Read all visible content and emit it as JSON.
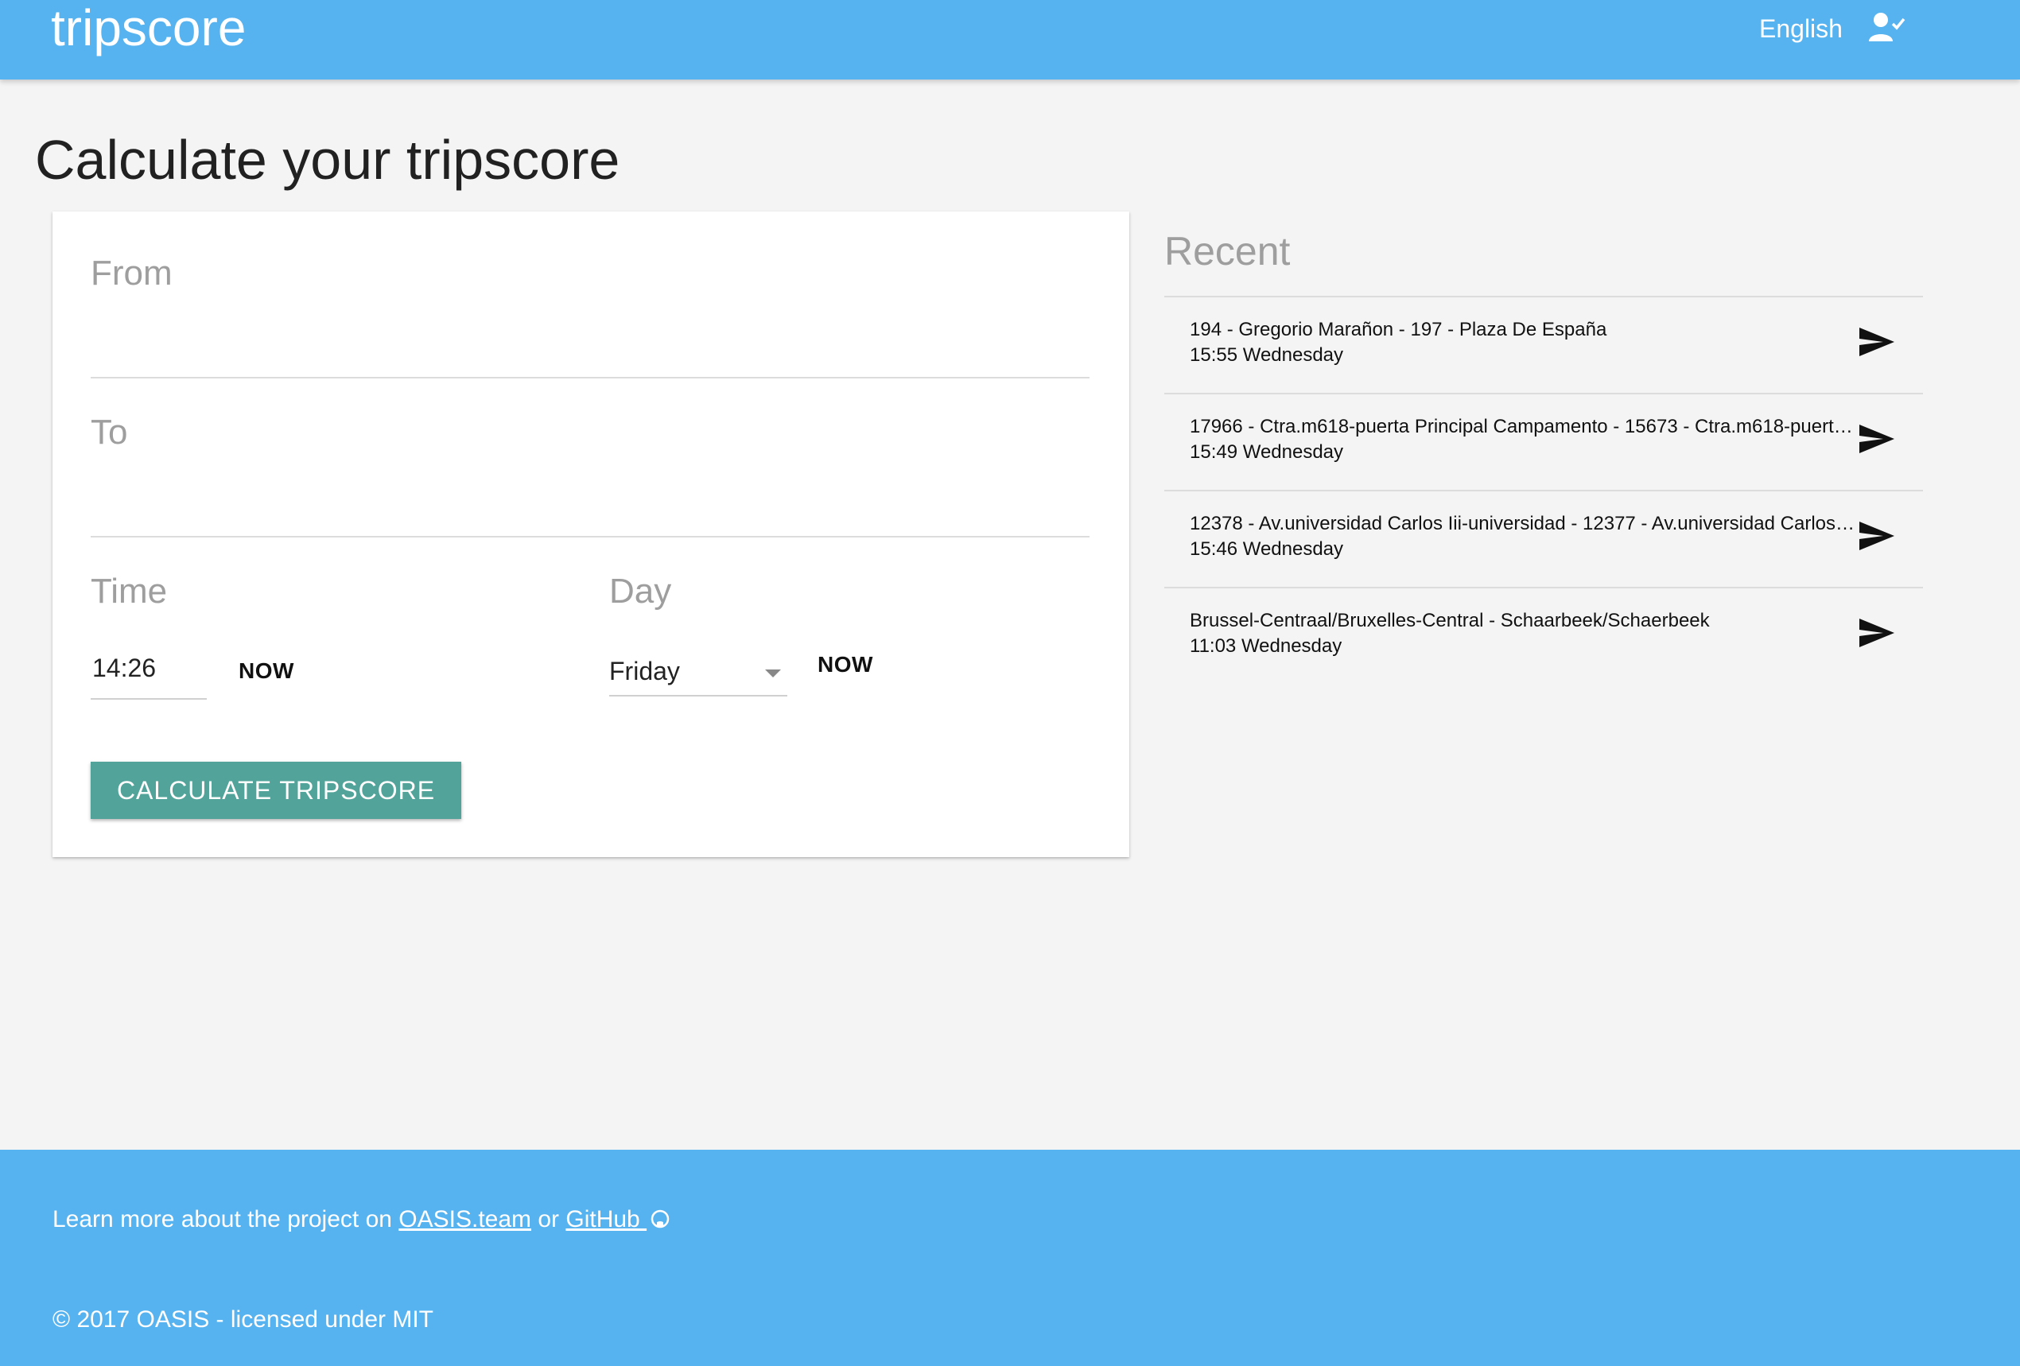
{
  "header": {
    "brand": "tripscore",
    "language": "English",
    "user_icon": "account-check-icon"
  },
  "page": {
    "title": "Calculate your tripscore"
  },
  "form": {
    "from_label": "From",
    "from_value": "",
    "to_label": "To",
    "to_value": "",
    "time_label": "Time",
    "time_value": "14:26",
    "time_now": "NOW",
    "day_label": "Day",
    "day_value": "Friday",
    "day_now": "NOW",
    "submit_label": "CALCULATE TRIPSCORE"
  },
  "recent": {
    "title": "Recent",
    "items": [
      {
        "route": "194 - Gregorio Marañon - 197 - Plaza De España",
        "time": "15:55 Wednesday"
      },
      {
        "route": "17966 - Ctra.m618-puerta Principal Campamento - 15673 - Ctra.m618-puerta ...",
        "time": "15:49 Wednesday"
      },
      {
        "route": "12378 - Av.universidad Carlos Iii-universidad - 12377 - Av.universidad Carlos Ii...",
        "time": "15:46 Wednesday"
      },
      {
        "route": "Brussel-Centraal/Bruxelles-Central - Schaarbeek/Schaerbeek",
        "time": "11:03 Wednesday"
      }
    ]
  },
  "footer": {
    "learn_prefix": "Learn more about the project on ",
    "oasis_link": "OASIS.team",
    "or_text": " or ",
    "github_link": "GitHub ",
    "copyright": "© 2017 OASIS - licensed under MIT"
  },
  "colors": {
    "header_bg": "#57b3f0",
    "button_bg": "#52a39a",
    "page_bg": "#f4f4f4"
  }
}
